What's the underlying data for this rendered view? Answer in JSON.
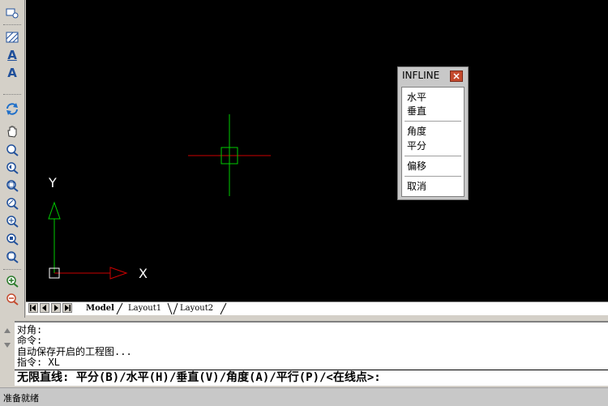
{
  "tabs": {
    "model": "Model",
    "layout1": "Layout1",
    "layout2": "Layout2"
  },
  "axis": {
    "x_label": "X",
    "y_label": "Y"
  },
  "popup": {
    "title": "INFLINE",
    "items": [
      "水平",
      "垂直",
      "角度",
      "平分",
      "偏移",
      "取消"
    ]
  },
  "command": {
    "history": [
      "对角:",
      "命令:",
      "自动保存开启的工程图...",
      "指令: XL"
    ],
    "prompt": "无限直线: 平分(B)/水平(H)/垂直(V)/角度(A)/平行(P)/<在线点>:"
  },
  "status": {
    "text": "准备就绪"
  },
  "colors": {
    "canvas": "#000000",
    "cursor_crosshair_x": "#cc0000",
    "cursor_crosshair_y": "#00cc00",
    "ucs_x": "#cc0000",
    "ucs_y": "#00cc00"
  },
  "toolbar_icons": [
    "insert-block-icon",
    "hatch-icon",
    "text-icon",
    "multiline-text-icon",
    "regen-icon",
    "pan-icon",
    "zoom-realtime-icon",
    "zoom-previous-icon",
    "zoom-window-icon",
    "zoom-dynamic-icon",
    "zoom-scale-icon",
    "zoom-center-icon",
    "zoom-extents-icon",
    "zoom-in-icon",
    "zoom-out-icon"
  ]
}
